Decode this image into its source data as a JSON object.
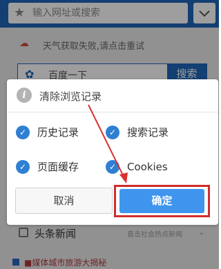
{
  "browser": {
    "address_placeholder": "输入网址或搜索",
    "weather_text": "天气获取失败,请点击重试",
    "search_input_value": "百度一下",
    "search_button": "搜索",
    "news_title": "头条新闻",
    "news_more": "直击社会热点新闻",
    "news_headline": "■媒体城市旅游大揭秘"
  },
  "dialog": {
    "title": "清除浏览记录",
    "options": [
      {
        "label": "历史记录",
        "checked": true
      },
      {
        "label": "搜索记录",
        "checked": true
      },
      {
        "label": "页面缓存",
        "checked": true
      },
      {
        "label": "Cookies",
        "checked": true
      }
    ],
    "cancel_label": "取消",
    "ok_label": "确定"
  },
  "colors": {
    "primary": "#1f66b8",
    "checkbox": "#2f7fd3",
    "confirm_button": "#3f95ee",
    "highlight": "#cf2c2c"
  },
  "icons": {
    "star": "★",
    "cloud": "☁",
    "paw": "✿",
    "check": "✓",
    "info": "i",
    "chevron": "⌄"
  }
}
